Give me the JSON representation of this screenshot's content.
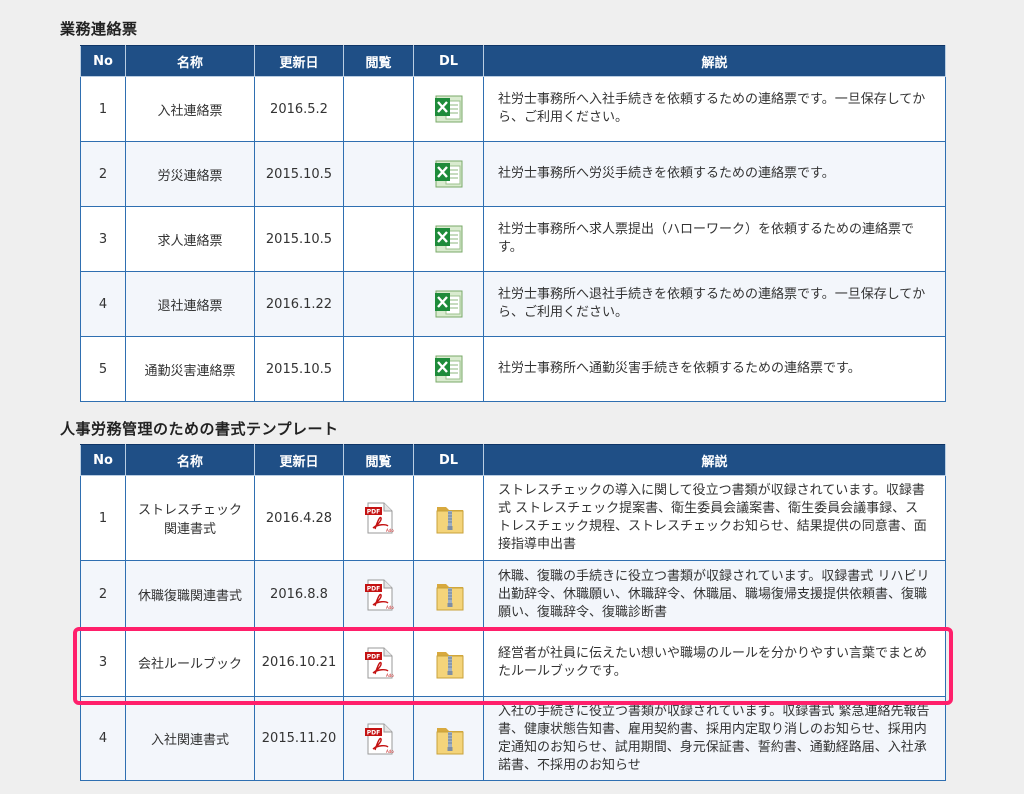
{
  "sections": [
    {
      "title": "業務連絡票",
      "headers": [
        "No",
        "名称",
        "更新日",
        "閲覧",
        "DL",
        "解説"
      ],
      "rows": [
        {
          "no": "1",
          "name": "入社連絡票",
          "date": "2016.5.2",
          "desc": "社労士事務所へ入社手続きを依頼するための連絡票です。一旦保存してから、ご利用ください。",
          "dl_icon": "excel-icon"
        },
        {
          "no": "2",
          "name": "労災連絡票",
          "date": "2015.10.5",
          "desc": "社労士事務所へ労災手続きを依頼するための連絡票です。",
          "dl_icon": "excel-icon"
        },
        {
          "no": "3",
          "name": "求人連絡票",
          "date": "2015.10.5",
          "desc": "社労士事務所へ求人票提出（ハローワーク）を依頼するための連絡票です。",
          "dl_icon": "excel-icon"
        },
        {
          "no": "4",
          "name": "退社連絡票",
          "date": "2016.1.22",
          "desc": "社労士事務所へ退社手続きを依頼するための連絡票です。一旦保存してから、ご利用ください。",
          "dl_icon": "excel-icon"
        },
        {
          "no": "5",
          "name": "通勤災害連絡票",
          "date": "2015.10.5",
          "desc": "社労士事務所へ通勤災害手続きを依頼するための連絡票です。",
          "dl_icon": "excel-icon"
        }
      ]
    },
    {
      "title": "人事労務管理のための書式テンプレート",
      "headers": [
        "No",
        "名称",
        "更新日",
        "閲覧",
        "DL",
        "解説"
      ],
      "rows": [
        {
          "no": "1",
          "name": "ストレスチェック関連書式",
          "date": "2016.4.28",
          "desc": "ストレスチェックの導入に関して役立つ書類が収録されています。収録書式 ストレスチェック提案書、衛生委員会議案書、衛生委員会議事録、ストレスチェック規程、ストレスチェックお知らせ、結果提供の同意書、面接指導申出書",
          "view_icon": "pdf-icon",
          "dl_icon": "zip-folder-icon"
        },
        {
          "no": "2",
          "name": "休職復職関連書式",
          "date": "2016.8.8",
          "desc": "休職、復職の手続きに役立つ書類が収録されています。収録書式 リハビリ出勤辞令、休職願い、休職辞令、休職届、職場復帰支援提供依頼書、復職願い、復職辞令、復職診断書",
          "view_icon": "pdf-icon",
          "dl_icon": "zip-folder-icon"
        },
        {
          "no": "3",
          "name": "会社ルールブック",
          "date": "2016.10.21",
          "desc": "経営者が社員に伝えたい想いや職場のルールを分かりやすい言葉でまとめたルールブックです。",
          "view_icon": "pdf-icon",
          "dl_icon": "zip-folder-icon"
        },
        {
          "no": "4",
          "name": "入社関連書式",
          "date": "2015.11.20",
          "desc": "入社の手続きに役立つ書類が収録されています。収録書式 緊急連絡先報告書、健康状態告知書、雇用契約書、採用内定取り消しのお知らせ、採用内定通知のお知らせ、試用期間、身元保証書、誓約書、通勤経路届、入社承諾書、不採用のお知らせ",
          "view_icon": "pdf-icon",
          "dl_icon": "zip-folder-icon"
        }
      ]
    }
  ],
  "colors": {
    "header_bg": "#1f4f86",
    "border": "#2f6fb1",
    "highlight": "#ff1f6b"
  }
}
